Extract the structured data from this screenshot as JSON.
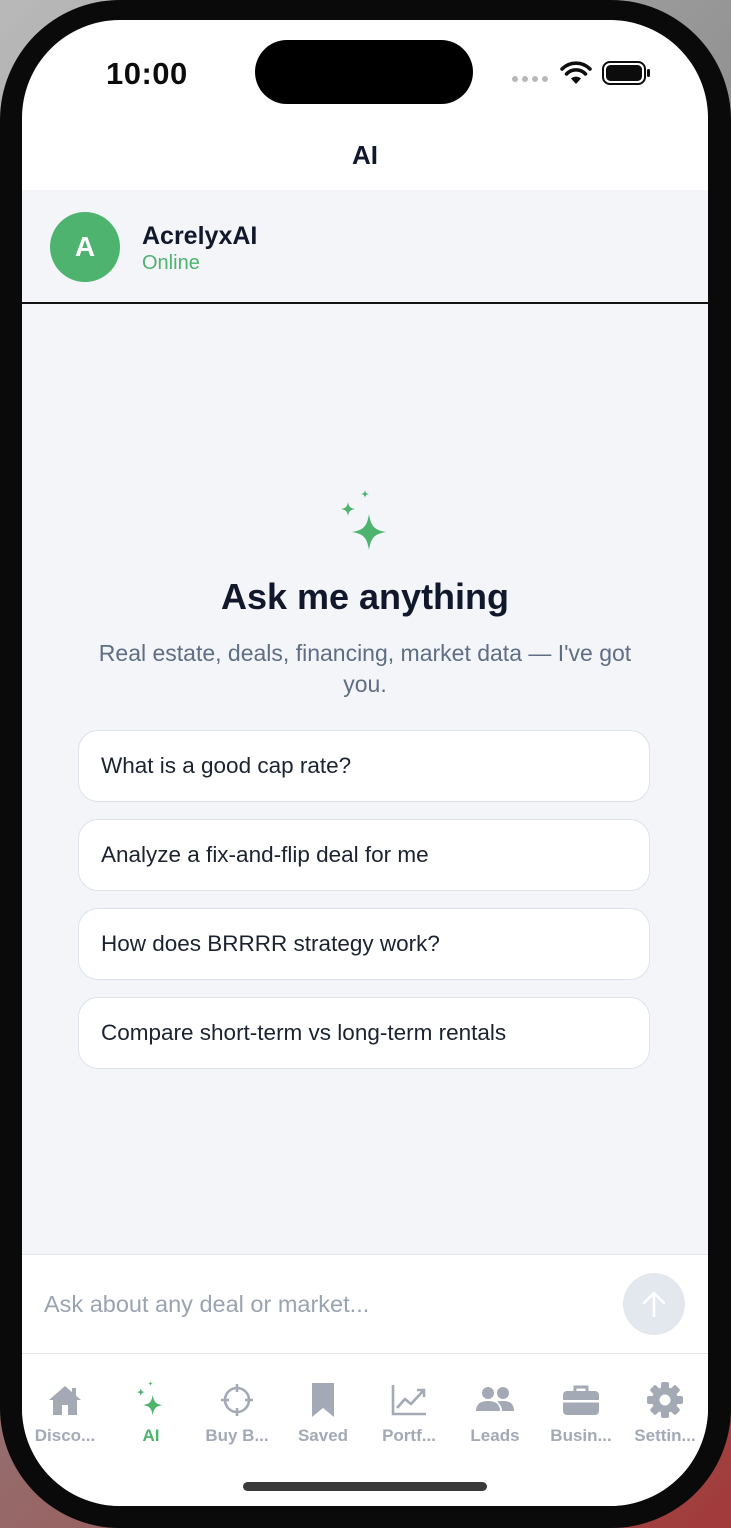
{
  "status_bar": {
    "time": "10:00"
  },
  "nav": {
    "title": "AI"
  },
  "chat_header": {
    "avatar_letter": "A",
    "agent_name": "AcrelyxAI",
    "agent_status": "Online"
  },
  "empty_state": {
    "icon": "sparkles-icon",
    "title": "Ask me anything",
    "subtitle": "Real estate, deals, financing, market data — I've got you."
  },
  "suggestions": [
    "What is a good cap rate?",
    "Analyze a fix-and-flip deal for me",
    "How does BRRRR strategy work?",
    "Compare short-term vs long-term rentals"
  ],
  "input": {
    "placeholder": "Ask about any deal or market..."
  },
  "tabs": [
    {
      "label": "Disco...",
      "icon": "house-icon",
      "active": false
    },
    {
      "label": "AI",
      "icon": "sparkles-icon",
      "active": true
    },
    {
      "label": "Buy B...",
      "icon": "crosshair-icon",
      "active": false
    },
    {
      "label": "Saved",
      "icon": "bookmark-icon",
      "active": false
    },
    {
      "label": "Portf...",
      "icon": "chart-line-icon",
      "active": false
    },
    {
      "label": "Leads",
      "icon": "people-icon",
      "active": false
    },
    {
      "label": "Busin...",
      "icon": "briefcase-icon",
      "active": false
    },
    {
      "label": "Settin...",
      "icon": "gear-icon",
      "active": false
    }
  ],
  "colors": {
    "accent": "#4db36f",
    "background": "#f3f5f9",
    "title_text": "#11182b",
    "inactive_tab": "#a3aab5"
  }
}
